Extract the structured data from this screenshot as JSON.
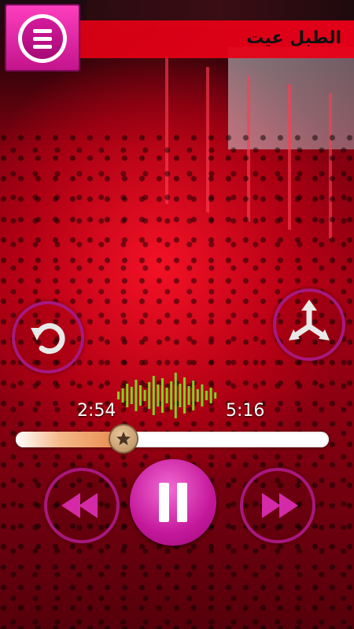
{
  "header": {
    "title": "الطبل عيت"
  },
  "player": {
    "elapsed": "2:54",
    "duration": "5:16",
    "progress": 0.345,
    "is_playing": true
  },
  "colors": {
    "accent": "#c2138b",
    "titlebar": "#e60018",
    "wave": "#7cd321"
  },
  "icons": {
    "menu": "menu-icon",
    "repeat": "repeat-icon",
    "shuffle": "shuffle-icon",
    "previous": "previous-icon",
    "pause": "pause-icon",
    "next": "next-icon",
    "seek_knob": "star-icon"
  }
}
